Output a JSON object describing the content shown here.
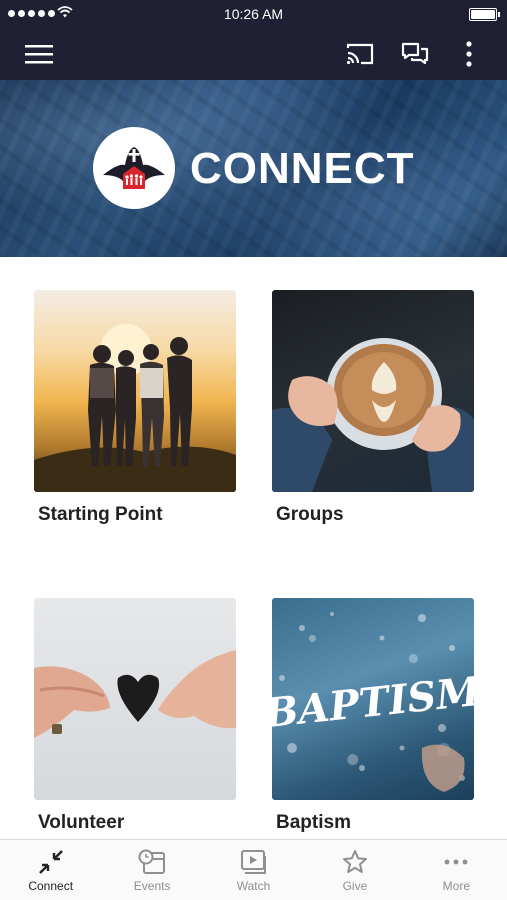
{
  "status_bar": {
    "time": "10:26 AM"
  },
  "app_bar": {
    "menu_icon": "hamburger-menu-icon",
    "cast_icon": "cast-icon",
    "chat_icon": "chat-bubbles-icon",
    "more_icon": "vertical-dots-icon"
  },
  "banner": {
    "title": "CONNECT",
    "logo_icon": "church-logo-icon"
  },
  "tiles": [
    {
      "label": "Starting Point"
    },
    {
      "label": "Groups"
    },
    {
      "label": "Volunteer"
    },
    {
      "label": "Baptism",
      "image_text": "BAPTISM"
    }
  ],
  "tab_bar": {
    "active": "Connect",
    "tabs": [
      {
        "label": "Connect",
        "icon": "connect-arrows-icon"
      },
      {
        "label": "Events",
        "icon": "calendar-clock-icon"
      },
      {
        "label": "Watch",
        "icon": "video-play-icon"
      },
      {
        "label": "Give",
        "icon": "star-icon"
      },
      {
        "label": "More",
        "icon": "horizontal-dots-icon"
      }
    ]
  },
  "colors": {
    "header_bg": "#1f2033",
    "active_tab": "#222222",
    "inactive_tab": "#8e8e93"
  }
}
